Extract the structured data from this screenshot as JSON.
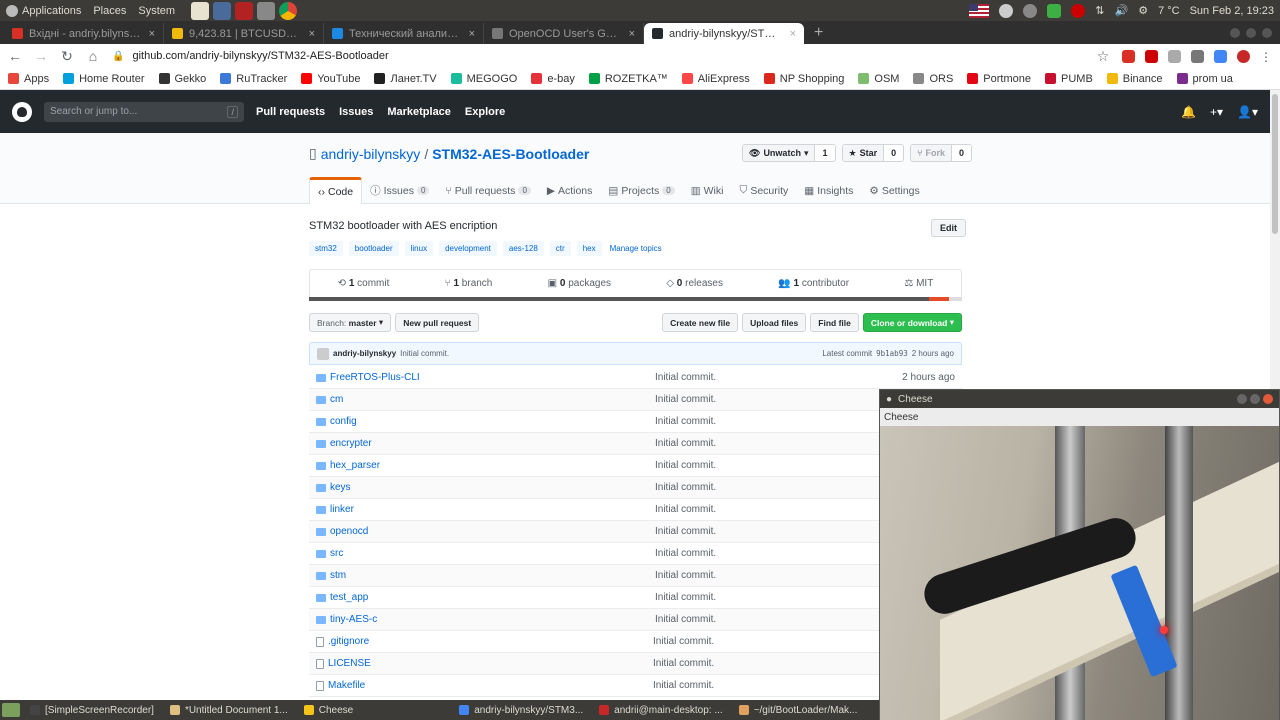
{
  "system_panel": {
    "menus": [
      "Applications",
      "Places",
      "System"
    ],
    "temperature": "7 °C",
    "clock": "Sun Feb 2, 19:23"
  },
  "tabs": [
    {
      "title": "Вхідні - andriy.bilynskyy@",
      "favicon_color": "#d93025"
    },
    {
      "title": "9,423.81 | BTCUSDT | Buy",
      "favicon_color": "#f0b90b"
    },
    {
      "title": "Технический анализ Bit",
      "favicon_color": "#1e88e5"
    },
    {
      "title": "OpenOCD User's Guide: G",
      "favicon_color": "#777777"
    },
    {
      "title": "andriy-bilynskyy/STM32-A",
      "favicon_color": "#24292e",
      "active": true
    }
  ],
  "address_bar": {
    "url": "github.com/andriy-bilynskyy/STM32-AES-Bootloader"
  },
  "bookmarks": [
    {
      "label": "Apps",
      "color": "#e8453c"
    },
    {
      "label": "Home Router",
      "color": "#00a0dc"
    },
    {
      "label": "Gekko",
      "color": "#333333"
    },
    {
      "label": "RuTracker",
      "color": "#3c78d8"
    },
    {
      "label": "YouTube",
      "color": "#ff0000"
    },
    {
      "label": "Ланет.TV",
      "color": "#222222"
    },
    {
      "label": "MEGOGO",
      "color": "#1abc9c"
    },
    {
      "label": "e-bay",
      "color": "#e53238"
    },
    {
      "label": "ROZETKA™",
      "color": "#00a046"
    },
    {
      "label": "AliExpress",
      "color": "#ff4747"
    },
    {
      "label": "NP Shopping",
      "color": "#da291c"
    },
    {
      "label": "OSM",
      "color": "#7ebc6f"
    },
    {
      "label": "ORS",
      "color": "#888888"
    },
    {
      "label": "Portmone",
      "color": "#e30613"
    },
    {
      "label": "PUMB",
      "color": "#c8102e"
    },
    {
      "label": "Binance",
      "color": "#f0b90b"
    },
    {
      "label": "prom ua",
      "color": "#7b2d8e"
    }
  ],
  "github": {
    "search_placeholder": "Search or jump to...",
    "search_shortcut": "/",
    "nav": [
      "Pull requests",
      "Issues",
      "Marketplace",
      "Explore"
    ],
    "owner": "andriy-bilynskyy",
    "separator": "/",
    "repo": "STM32-AES-Bootloader",
    "watch": {
      "label": "Unwatch",
      "count": "1"
    },
    "star": {
      "label": "Star",
      "count": "0"
    },
    "fork": {
      "label": "Fork",
      "count": "0"
    },
    "repo_nav": [
      {
        "label": "Code",
        "icon": "code-icon",
        "selected": true
      },
      {
        "label": "Issues",
        "count": "0",
        "icon": "issue-icon"
      },
      {
        "label": "Pull requests",
        "count": "0",
        "icon": "pr-icon"
      },
      {
        "label": "Actions",
        "icon": "play-icon"
      },
      {
        "label": "Projects",
        "count": "0",
        "icon": "project-icon"
      },
      {
        "label": "Wiki",
        "icon": "book-icon"
      },
      {
        "label": "Security",
        "icon": "shield-icon"
      },
      {
        "label": "Insights",
        "icon": "graph-icon"
      },
      {
        "label": "Settings",
        "icon": "gear-icon"
      }
    ],
    "description": "STM32 bootloader with AES encription",
    "edit_label": "Edit",
    "topics": [
      "stm32",
      "bootloader",
      "linux",
      "development",
      "aes-128",
      "ctr",
      "hex"
    ],
    "manage_topics": "Manage topics",
    "summary": [
      {
        "num": "1",
        "label": "commit"
      },
      {
        "num": "1",
        "label": "branch"
      },
      {
        "num": "0",
        "label": "packages"
      },
      {
        "num": "0",
        "label": "releases"
      },
      {
        "num": "1",
        "label": "contributor"
      },
      {
        "num": "",
        "label": "MIT"
      }
    ],
    "branch_label": "Branch:",
    "branch": "master",
    "new_pr": "New pull request",
    "create_file": "Create new file",
    "upload_files": "Upload files",
    "find_file": "Find file",
    "clone": "Clone or download",
    "commit": {
      "author": "andriy-bilynskyy",
      "message": "Initial commit.",
      "latest_label": "Latest commit",
      "sha": "9b1ab93",
      "age": "2 hours ago"
    },
    "files": [
      {
        "name": "FreeRTOS-Plus-CLI",
        "type": "dir",
        "msg": "Initial commit.",
        "age": "2 hours ago"
      },
      {
        "name": "cm",
        "type": "dir",
        "msg": "Initial commit.",
        "age": ""
      },
      {
        "name": "config",
        "type": "dir",
        "msg": "Initial commit.",
        "age": ""
      },
      {
        "name": "encrypter",
        "type": "dir",
        "msg": "Initial commit.",
        "age": ""
      },
      {
        "name": "hex_parser",
        "type": "dir",
        "msg": "Initial commit.",
        "age": ""
      },
      {
        "name": "keys",
        "type": "dir",
        "msg": "Initial commit.",
        "age": ""
      },
      {
        "name": "linker",
        "type": "dir",
        "msg": "Initial commit.",
        "age": ""
      },
      {
        "name": "openocd",
        "type": "dir",
        "msg": "Initial commit.",
        "age": ""
      },
      {
        "name": "src",
        "type": "dir",
        "msg": "Initial commit.",
        "age": ""
      },
      {
        "name": "stm",
        "type": "dir",
        "msg": "Initial commit.",
        "age": ""
      },
      {
        "name": "test_app",
        "type": "dir",
        "msg": "Initial commit.",
        "age": ""
      },
      {
        "name": "tiny-AES-c",
        "type": "dir",
        "msg": "Initial commit.",
        "age": ""
      },
      {
        "name": ".gitignore",
        "type": "file",
        "msg": "Initial commit.",
        "age": ""
      },
      {
        "name": "LICENSE",
        "type": "file",
        "msg": "Initial commit.",
        "age": ""
      },
      {
        "name": "Makefile",
        "type": "file",
        "msg": "Initial commit.",
        "age": ""
      }
    ]
  },
  "cheese": {
    "title": "Cheese",
    "menu": "Cheese"
  },
  "taskbar": [
    {
      "label": "[SimpleScreenRecorder]",
      "color": "#444444"
    },
    {
      "label": "*Untitled Document 1...",
      "color": "#e0c080"
    },
    {
      "label": "Cheese",
      "color": "#f5c518"
    },
    {
      "label": "andriy-bilynskyy/STM3...",
      "color": "#4285f4"
    },
    {
      "label": "andrii@main-desktop: ...",
      "color": "#c62828"
    },
    {
      "label": "~/git/BootLoader/Mak...",
      "color": "#e0a060"
    }
  ]
}
